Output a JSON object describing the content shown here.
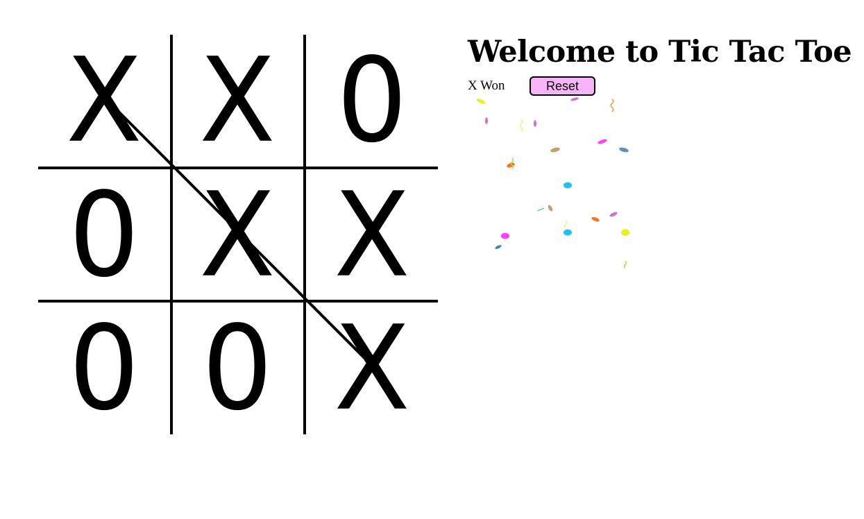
{
  "board": {
    "cells": [
      "X",
      "X",
      "0",
      "0",
      "X",
      "X",
      "0",
      "0",
      "X"
    ],
    "winning_line": [
      0,
      8
    ]
  },
  "title": "Welcome to Tic Tac Toe",
  "status": "X Won",
  "reset_label": "Reset",
  "colors": {
    "reset_button_bg": "#f8b4f8",
    "confetti": [
      "#e8f020",
      "#d070d0",
      "#f0a040",
      "#ff40ff",
      "#c0a070",
      "#6090c0",
      "#ff7020",
      "#20c0f0",
      "#a0e040",
      "#ff50a0",
      "#4080c0"
    ]
  }
}
